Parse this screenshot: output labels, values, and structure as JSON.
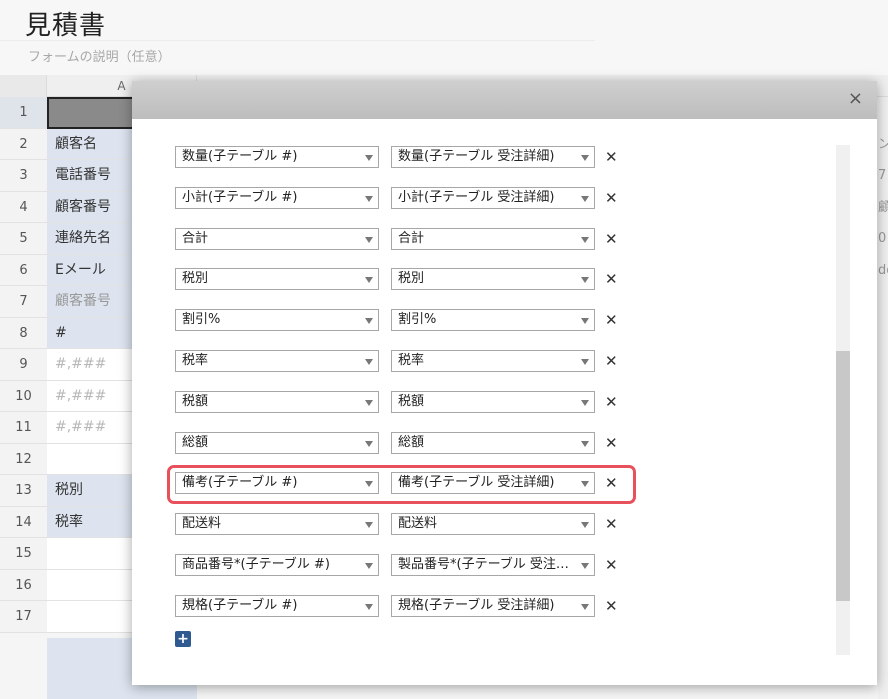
{
  "form": {
    "title": "見積書",
    "description": "フォームの説明（任意）"
  },
  "sheet": {
    "column_a": "A",
    "rows": [
      "1",
      "2",
      "3",
      "4",
      "5",
      "6",
      "7",
      "8",
      "9",
      "10",
      "11",
      "12",
      "13",
      "14",
      "15",
      "16",
      "17"
    ],
    "cells": [
      "",
      "顧客名",
      "電話番号",
      "顧客番号",
      "連絡先名",
      "Eメール",
      "顧客番号",
      "#",
      "#,###",
      "#,###",
      "#,###",
      "",
      "税別",
      "税率",
      "",
      "",
      ""
    ],
    "right_fragments": [
      "",
      "ン",
      "7",
      "顧",
      "0",
      "do",
      "",
      "",
      "",
      "",
      "",
      "",
      "",
      "",
      "",
      "",
      ""
    ]
  },
  "modal": {
    "close_glyph": "×",
    "delete_glyph": "✕",
    "add_glyph": "+",
    "mappings": [
      {
        "left": "数量(子テーブル #)",
        "right": "数量(子テーブル 受注詳細)"
      },
      {
        "left": "小計(子テーブル #)",
        "right": "小計(子テーブル 受注詳細)"
      },
      {
        "left": "合計",
        "right": "合計"
      },
      {
        "left": "税別",
        "right": "税別"
      },
      {
        "left": "割引%",
        "right": "割引%"
      },
      {
        "left": "税率",
        "right": "税率"
      },
      {
        "left": "税額",
        "right": "税額"
      },
      {
        "left": "総額",
        "right": "総額"
      },
      {
        "left": "備考(子テーブル #)",
        "right": "備考(子テーブル 受注詳細)"
      },
      {
        "left": "配送料",
        "right": "配送料"
      },
      {
        "left": "商品番号*(子テーブル #)",
        "right": "製品番号*(子テーブル 受注…"
      },
      {
        "left": "規格(子テーブル #)",
        "right": "規格(子テーブル 受注詳細)"
      }
    ]
  },
  "colors": {
    "highlight": "#e8505b",
    "add_button": "#2f5a8f",
    "label_cell": "#dde4ef"
  }
}
